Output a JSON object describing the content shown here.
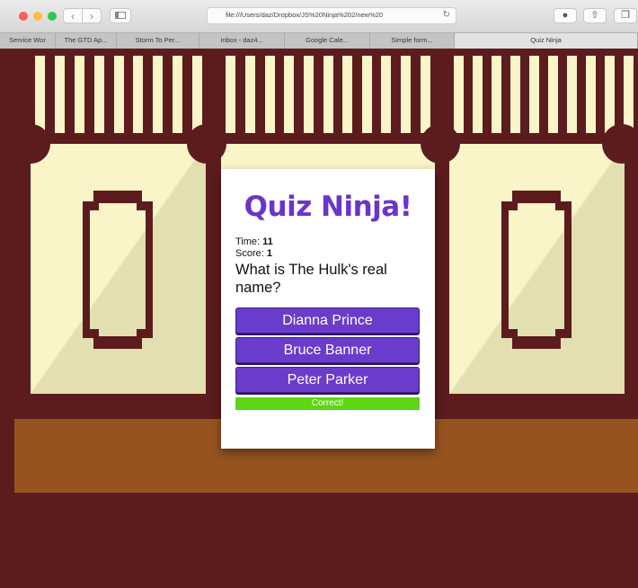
{
  "browser": {
    "address": "file:///Users/daz/Dropbox/JS%20Ninja%202/new%20",
    "tabs": [
      {
        "label": "Service Wor"
      },
      {
        "label": "The GTD Ap..."
      },
      {
        "label": "Storm To Per..."
      },
      {
        "label": "Inbox - daz4..."
      },
      {
        "label": "Google Cale..."
      },
      {
        "label": "Simple form..."
      },
      {
        "label": "Quiz Ninja"
      }
    ],
    "active_tab": "Quiz Ninja",
    "icons": [
      "back-icon",
      "forward-icon",
      "sidebar-icon",
      "reload-icon",
      "downloads-icon",
      "share-icon",
      "tabs-icon"
    ]
  },
  "quiz": {
    "title": "Quiz Ninja!",
    "time_label": "Time: ",
    "time_value": "11",
    "score_label": "Score: ",
    "score_value": "1",
    "question": "What is The Hulk's real name?",
    "answers": [
      "Dianna Prince",
      "Bruce Banner",
      "Peter Parker"
    ],
    "feedback": "Correct!"
  },
  "colors": {
    "brand": "#6a35c8",
    "button": "#6a3ccb",
    "success": "#5cd615",
    "wall": "#5c1c1e",
    "cream": "#faf5c8",
    "floor": "#97531f"
  }
}
